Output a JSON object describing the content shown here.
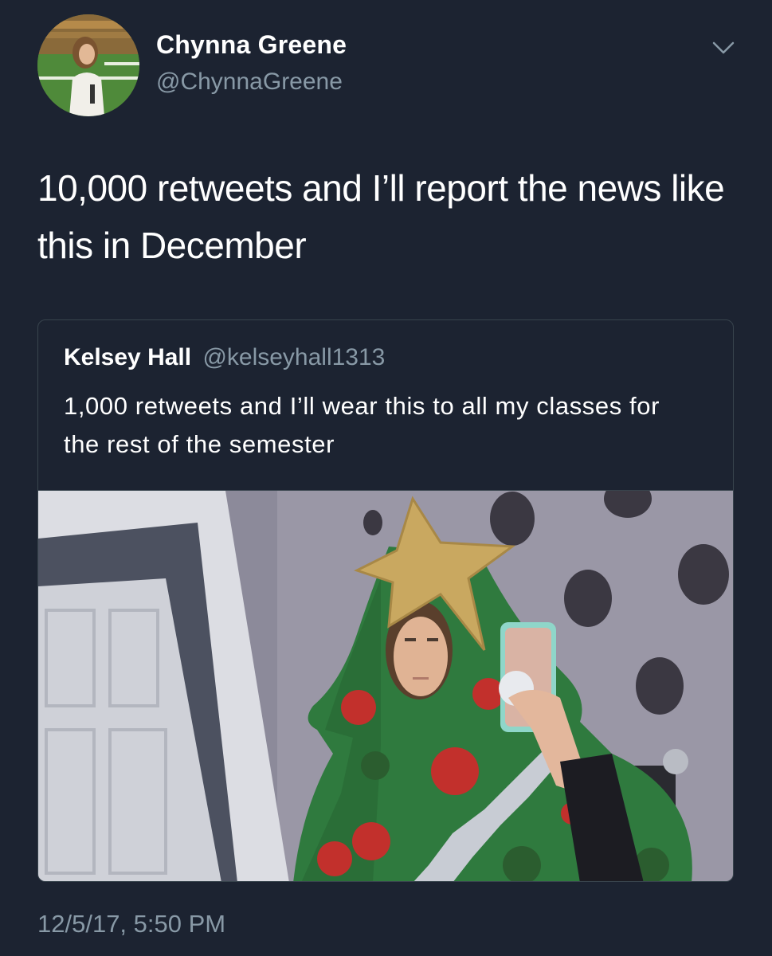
{
  "tweet": {
    "author": {
      "display_name": "Chynna Greene",
      "handle": "@ChynnaGreene",
      "avatar_icon": "avatar-photo"
    },
    "menu_icon": "chevron-down-icon",
    "text": "10,000 retweets and I’ll report the news like this in December",
    "timestamp": "12/5/17, 5:50 PM",
    "quoted_tweet": {
      "display_name": "Kelsey Hall",
      "handle": "@kelseyhall1313",
      "text": "1,000 retweets and I’ll wear this to all my classes for the rest of the semester",
      "media_icon": "quoted-photo"
    }
  },
  "colors": {
    "background": "#1c2331",
    "primary_text": "#ffffff",
    "secondary_text": "#8899a6",
    "border": "#38444d"
  }
}
